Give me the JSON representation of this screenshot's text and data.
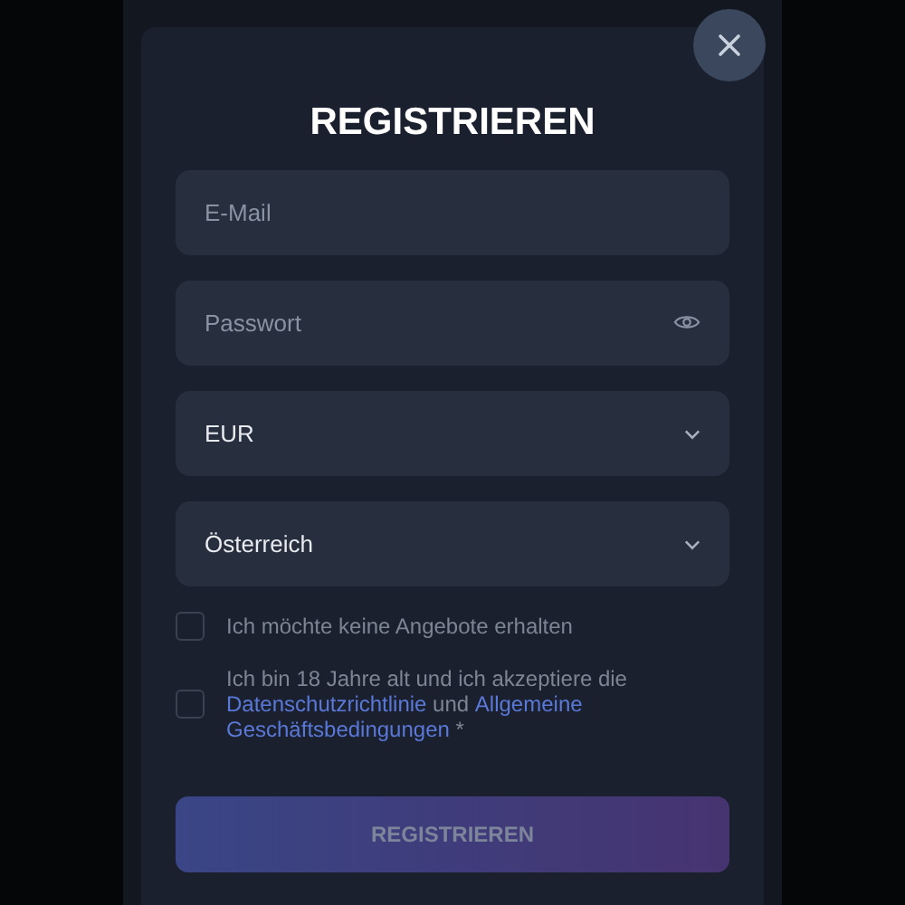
{
  "dialog": {
    "title": "REGISTRIEREN",
    "fields": [
      {
        "kind": "text",
        "placeholder": "E-Mail"
      },
      {
        "kind": "password",
        "placeholder": "Passwort"
      },
      {
        "kind": "select",
        "value": "EUR"
      },
      {
        "kind": "select",
        "value": "Österreich"
      }
    ],
    "checkboxes": [
      {
        "checked": false,
        "parts": [
          {
            "kind": "text",
            "text": "Ich möchte keine Angebote erhalten"
          }
        ]
      },
      {
        "checked": false,
        "parts": [
          {
            "kind": "text",
            "text": "Ich bin 18 Jahre alt und ich akzeptiere die "
          },
          {
            "kind": "link",
            "text": "Datenschutzrichtlinie"
          },
          {
            "kind": "text",
            "text": " und "
          },
          {
            "kind": "link",
            "text": "Allgemeine"
          },
          {
            "kind": "link",
            "text": "Geschäftsbedingungen"
          },
          {
            "kind": "text",
            "text": " *"
          }
        ]
      }
    ],
    "submit": {
      "label": "REGISTRIEREN",
      "disabled": true
    }
  }
}
